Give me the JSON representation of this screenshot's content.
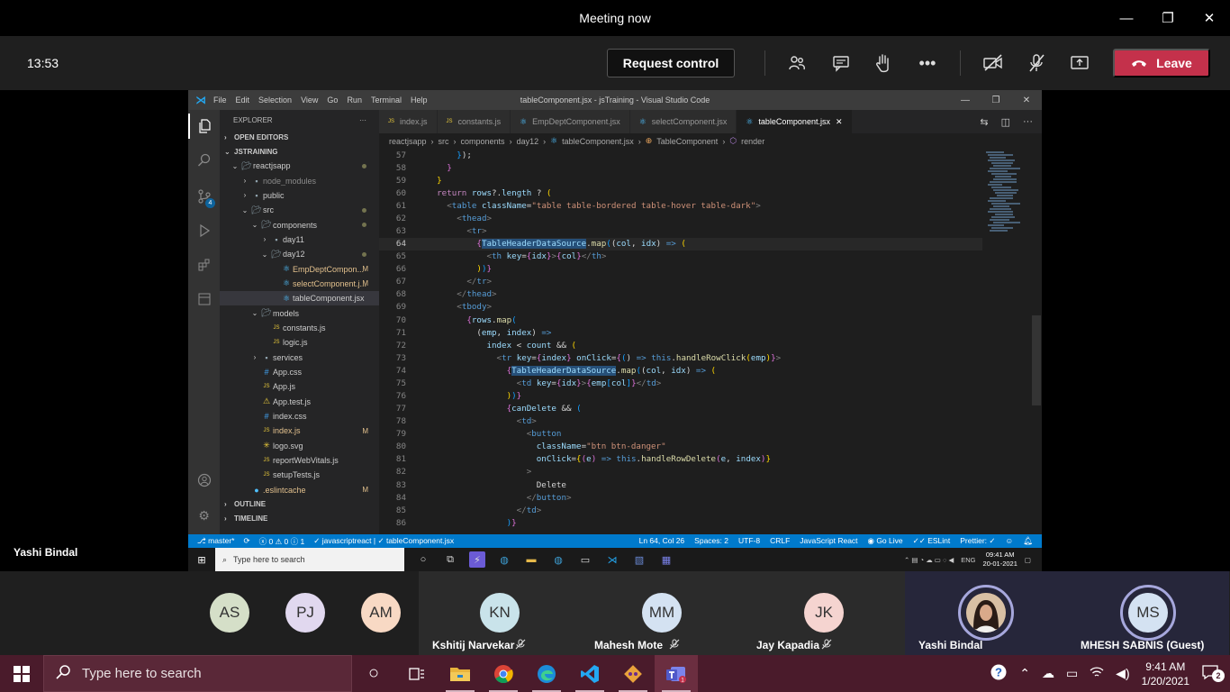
{
  "teams": {
    "title": "Meeting now",
    "timer": "13:53",
    "request_control": "Request control",
    "leave": "Leave",
    "presenter": "Yashi Bindal"
  },
  "vscode": {
    "window_title": "tableComponent.jsx - jsTraining - Visual Studio Code",
    "menu": [
      "File",
      "Edit",
      "Selection",
      "View",
      "Go",
      "Run",
      "Terminal",
      "Help"
    ],
    "explorer_label": "EXPLORER",
    "open_editors": "OPEN EDITORS",
    "workspace": "JSTRAINING",
    "outline": "OUTLINE",
    "timeline": "TIMELINE",
    "scm_badge": "4",
    "tree": [
      {
        "name": "reactjsapp",
        "depth": 1,
        "type": "folder-open",
        "dot": true
      },
      {
        "name": "node_modules",
        "depth": 2,
        "type": "folder-closed",
        "dim": true
      },
      {
        "name": "public",
        "depth": 2,
        "type": "folder-closed"
      },
      {
        "name": "src",
        "depth": 2,
        "type": "folder-open",
        "dot": true
      },
      {
        "name": "components",
        "depth": 3,
        "type": "folder-open",
        "dot": true
      },
      {
        "name": "day11",
        "depth": 4,
        "type": "folder-closed"
      },
      {
        "name": "day12",
        "depth": 4,
        "type": "folder-open",
        "dot": true
      },
      {
        "name": "EmpDeptCompon...",
        "depth": 5,
        "type": "react",
        "badge": "M",
        "mod": true
      },
      {
        "name": "selectComponent.j...",
        "depth": 5,
        "type": "react",
        "badge": "M",
        "mod": true
      },
      {
        "name": "tableComponent.jsx",
        "depth": 5,
        "type": "react",
        "selected": true
      },
      {
        "name": "models",
        "depth": 3,
        "type": "folder-open"
      },
      {
        "name": "constants.js",
        "depth": 4,
        "type": "js"
      },
      {
        "name": "logic.js",
        "depth": 4,
        "type": "js"
      },
      {
        "name": "services",
        "depth": 3,
        "type": "folder-closed"
      },
      {
        "name": "App.css",
        "depth": 3,
        "type": "css"
      },
      {
        "name": "App.js",
        "depth": 3,
        "type": "js"
      },
      {
        "name": "App.test.js",
        "depth": 3,
        "type": "test"
      },
      {
        "name": "index.css",
        "depth": 3,
        "type": "css"
      },
      {
        "name": "index.js",
        "depth": 3,
        "type": "js",
        "badge": "M",
        "mod": true
      },
      {
        "name": "logo.svg",
        "depth": 3,
        "type": "svg"
      },
      {
        "name": "reportWebVitals.js",
        "depth": 3,
        "type": "js"
      },
      {
        "name": "setupTests.js",
        "depth": 3,
        "type": "js"
      },
      {
        "name": ".eslintcache",
        "depth": 2,
        "type": "file",
        "badge": "M",
        "mod": true
      }
    ],
    "tabs": [
      {
        "label": "index.js",
        "icon": "JS"
      },
      {
        "label": "constants.js",
        "icon": "JS"
      },
      {
        "label": "EmpDeptComponent.jsx",
        "icon": "⚛"
      },
      {
        "label": "selectComponent.jsx",
        "icon": "⚛"
      },
      {
        "label": "tableComponent.jsx",
        "icon": "⚛",
        "active": true
      }
    ],
    "breadcrumb": [
      "reactjsapp",
      "src",
      "components",
      "day12",
      "tableComponent.jsx",
      "TableComponent",
      "render"
    ],
    "code": [
      {
        "n": "57",
        "html": "        <span class=\"br3\">}</span>);"
      },
      {
        "n": "58",
        "html": "      <span class=\"br2\">}</span>"
      },
      {
        "n": "59",
        "html": "    <span class=\"br1\">}</span>"
      },
      {
        "n": "60",
        "html": "    <span class=\"kc\">return</span> <span class=\"vr\">rows</span>?.<span class=\"vr\">length</span> ? <span class=\"br1\">(</span>"
      },
      {
        "n": "61",
        "html": "      <span class=\"tp\">&lt;</span><span class=\"tg\">table</span> <span class=\"at\">className</span>=<span class=\"st\">\"table table-bordered table-hover table-dark\"</span><span class=\"tp\">&gt;</span>"
      },
      {
        "n": "62",
        "html": "        <span class=\"tp\">&lt;</span><span class=\"tg\">thead</span><span class=\"tp\">&gt;</span>"
      },
      {
        "n": "63",
        "html": "          <span class=\"tp\">&lt;</span><span class=\"tg\">tr</span><span class=\"tp\">&gt;</span>"
      },
      {
        "n": "64",
        "html": "            <span class=\"br2\">{</span><span class=\"vr hl\">TableHeaderDataSource</span>.<span class=\"fn\">map</span><span class=\"br3\">(</span>(<span class=\"vr\">col</span>, <span class=\"vr\">idx</span>) <span class=\"k\">=&gt;</span> <span class=\"br1\">(</span>",
        "current": true
      },
      {
        "n": "65",
        "html": "              <span class=\"tp\">&lt;</span><span class=\"tg\">th</span> <span class=\"at\">key</span>=<span class=\"br2\">{</span><span class=\"vr\">idx</span><span class=\"br2\">}</span><span class=\"tp\">&gt;</span><span class=\"br2\">{</span><span class=\"vr\">col</span><span class=\"br2\">}</span><span class=\"tp\">&lt;/</span><span class=\"tg\">th</span><span class=\"tp\">&gt;</span>"
      },
      {
        "n": "66",
        "html": "            <span class=\"br1\">)</span><span class=\"br3\">)</span><span class=\"br2\">}</span>"
      },
      {
        "n": "67",
        "html": "          <span class=\"tp\">&lt;/</span><span class=\"tg\">tr</span><span class=\"tp\">&gt;</span>"
      },
      {
        "n": "68",
        "html": "        <span class=\"tp\">&lt;/</span><span class=\"tg\">thead</span><span class=\"tp\">&gt;</span>"
      },
      {
        "n": "69",
        "html": "        <span class=\"tp\">&lt;</span><span class=\"tg\">tbody</span><span class=\"tp\">&gt;</span>"
      },
      {
        "n": "70",
        "html": "          <span class=\"br2\">{</span><span class=\"vr\">rows</span>.<span class=\"fn\">map</span><span class=\"br3\">(</span>"
      },
      {
        "n": "71",
        "html": "            (<span class=\"vr\">emp</span>, <span class=\"vr\">index</span>) <span class=\"k\">=&gt;</span>"
      },
      {
        "n": "72",
        "html": "              <span class=\"vr\">index</span> &lt; <span class=\"vr\">count</span> &amp;&amp; <span class=\"br1\">(</span>"
      },
      {
        "n": "73",
        "html": "                <span class=\"tp\">&lt;</span><span class=\"tg\">tr</span> <span class=\"at\">key</span>=<span class=\"br2\">{</span><span class=\"vr\">index</span><span class=\"br2\">}</span> <span class=\"at\">onClick</span>=<span class=\"br2\">{</span><span class=\"br3\">(</span>) <span class=\"k\">=&gt;</span> <span class=\"k\">this</span>.<span class=\"fn\">handleRowClick</span><span class=\"br1\">(</span><span class=\"vr\">emp</span><span class=\"br1\">)</span><span class=\"br2\">}</span><span class=\"tp\">&gt;</span>"
      },
      {
        "n": "74",
        "html": "                  <span class=\"br2\">{</span><span class=\"vr hl\">TableHeaderDataSource</span>.<span class=\"fn\">map</span><span class=\"br3\">(</span>(<span class=\"vr\">col</span>, <span class=\"vr\">idx</span>) <span class=\"k\">=&gt;</span> <span class=\"br1\">(</span>"
      },
      {
        "n": "75",
        "html": "                    <span class=\"tp\">&lt;</span><span class=\"tg\">td</span> <span class=\"at\">key</span>=<span class=\"br2\">{</span><span class=\"vr\">idx</span><span class=\"br2\">}</span><span class=\"tp\">&gt;</span><span class=\"br2\">{</span><span class=\"vr\">emp</span><span class=\"br3\">[</span><span class=\"vr\">col</span><span class=\"br3\">]</span><span class=\"br2\">}</span><span class=\"tp\">&lt;/</span><span class=\"tg\">td</span><span class=\"tp\">&gt;</span>"
      },
      {
        "n": "76",
        "html": "                  <span class=\"br1\">)</span><span class=\"br3\">)</span><span class=\"br2\">}</span>"
      },
      {
        "n": "77",
        "html": "                  <span class=\"br2\">{</span><span class=\"vr\">canDelete</span> &amp;&amp; <span class=\"br3\">(</span>"
      },
      {
        "n": "78",
        "html": "                    <span class=\"tp\">&lt;</span><span class=\"tg\">td</span><span class=\"tp\">&gt;</span>"
      },
      {
        "n": "79",
        "html": "                      <span class=\"tp\">&lt;</span><span class=\"tg\">button</span>"
      },
      {
        "n": "80",
        "html": "                        <span class=\"at\">className</span>=<span class=\"st\">\"btn btn-danger\"</span>"
      },
      {
        "n": "81",
        "html": "                        <span class=\"at\">onClick</span>=<span class=\"br1\">{</span><span class=\"br2\">(</span><span class=\"vr\">e</span><span class=\"br2\">)</span> <span class=\"k\">=&gt;</span> <span class=\"k\">this</span>.<span class=\"fn\">handleRowDelete</span><span class=\"br2\">(</span><span class=\"vr\">e</span>, <span class=\"vr\">index</span><span class=\"br2\">)</span><span class=\"br1\">}</span>"
      },
      {
        "n": "82",
        "html": "                      <span class=\"tp\">&gt;</span>"
      },
      {
        "n": "83",
        "html": "                        <span class=\"tx\">Delete</span>"
      },
      {
        "n": "84",
        "html": "                      <span class=\"tp\">&lt;/</span><span class=\"tg\">button</span><span class=\"tp\">&gt;</span>"
      },
      {
        "n": "85",
        "html": "                    <span class=\"tp\">&lt;/</span><span class=\"tg\">td</span><span class=\"tp\">&gt;</span>"
      },
      {
        "n": "86",
        "html": "                  <span class=\"br3\">)</span><span class=\"br2\">}</span>"
      },
      {
        "n": "87",
        "html": "                <span class=\"tp\">&lt;/</span><span class=\"tg\">tr</span><span class=\"tp\">&gt;</span>"
      }
    ],
    "status": {
      "branch": "master*",
      "problems": "0",
      "warnings": "0",
      "info": "1",
      "project": "javascriptreact",
      "file": "tableComponent.jsx",
      "position": "Ln 64, Col 26",
      "spaces": "Spaces: 2",
      "encoding": "UTF-8",
      "eol": "CRLF",
      "language": "JavaScript React",
      "golive": "Go Live",
      "eslint": "ESLint",
      "prettier": "Prettier: ✓"
    },
    "taskbar": {
      "search_placeholder": "Type here to search",
      "time": "09:41 AM",
      "date": "20-01-2021",
      "lang": "ENG"
    }
  },
  "participants": [
    {
      "initials": "AS",
      "color": "#d5dfc8",
      "name": ""
    },
    {
      "initials": "PJ",
      "color": "#e1d8ef",
      "name": ""
    },
    {
      "initials": "AM",
      "color": "#f8d9c4",
      "name": ""
    },
    {
      "initials": "KN",
      "color": "#c9e3ea",
      "name": "Kshitij Narvekar",
      "muted": true
    },
    {
      "initials": "MM",
      "color": "#d4e2f2",
      "name": "Mahesh Mote",
      "muted": true
    },
    {
      "initials": "JK",
      "color": "#f5d4d0",
      "name": "Jay Kapadia",
      "muted": true
    },
    {
      "initials": "",
      "color": "#c9a47e",
      "name": "Yashi Bindal",
      "photo": true
    },
    {
      "initials": "MS",
      "color": "#d4e2f2",
      "name": "MHESH SABNIS (Guest)"
    }
  ],
  "win_taskbar": {
    "search_placeholder": "Type here to search",
    "time": "9:41 AM",
    "date": "1/20/2021",
    "notifications": "2"
  }
}
